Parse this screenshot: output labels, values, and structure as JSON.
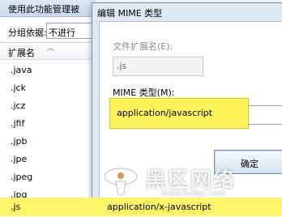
{
  "background_window": {
    "title": "使用此功能管理被",
    "group_label": "分组依据:",
    "group_value": "不进行",
    "column_header": "扩展名",
    "extensions": [
      ".java",
      ".jck",
      ".jcz",
      ".jfif",
      ".jpb",
      ".jpe",
      ".jpeg",
      ".jpg"
    ],
    "selected_row": {
      "ext": ".js",
      "mime": "application/x-javascript"
    }
  },
  "dialog": {
    "title": "编辑 MIME 类型",
    "ext_label": "文件扩展名(E):",
    "ext_value": ".js",
    "mime_label": "MIME 类型(M):",
    "mime_value": "application/javascript",
    "ok_label": "确定"
  },
  "watermark": {
    "text": "黑区网络",
    "url": "www.heiqu.com"
  },
  "colors": {
    "highlight": "#fff56a",
    "dialog_bg": "#dfe9f4"
  }
}
